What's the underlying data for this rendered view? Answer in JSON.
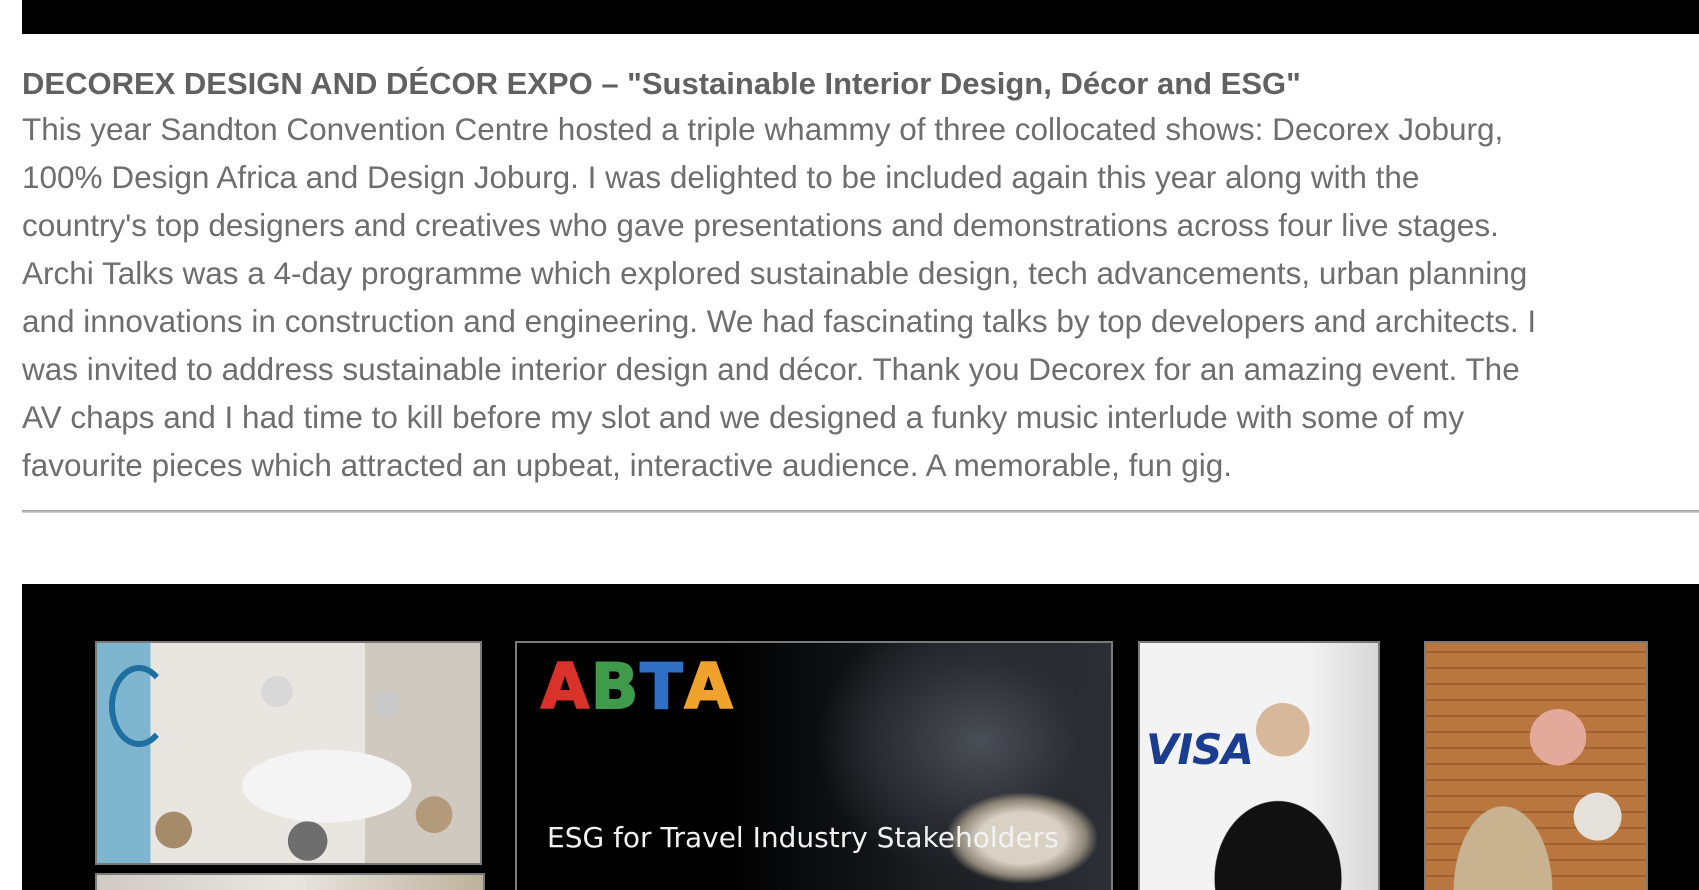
{
  "article": {
    "title": "DECOREX DESIGN AND DÉCOR EXPO – \"Sustainable Interior Design, Décor and ESG\"",
    "body_lines": [
      "This year Sandton Convention Centre hosted a triple whammy of three collocated shows: Decorex Joburg,",
      "100% Design Africa and Design Joburg. I was delighted to be included again this year along with the",
      "country's top designers and creatives who gave presentations and demonstrations across four live stages.",
      "Archi Talks was a 4-day programme which explored sustainable design, tech advancements, urban planning",
      "and innovations in construction and engineering. We had fascinating talks by top developers and architects. I",
      "was invited to address sustainable interior design and décor. Thank you Decorex for an amazing event. The",
      "AV chaps and I had time to kill before my slot and we designed a funky music interlude with some of my",
      "favourite pieces which attracted an upbeat, interactive audience. A memorable, fun gig."
    ]
  },
  "gallery": {
    "abta_logo": [
      "A",
      "B",
      "T",
      "A"
    ],
    "abta_caption": "ESG for Travel Industry Stakeholders",
    "visa_text": "VISA"
  },
  "colors": {
    "title": "#616161",
    "body": "#6e6e6e",
    "band": "#000000"
  }
}
